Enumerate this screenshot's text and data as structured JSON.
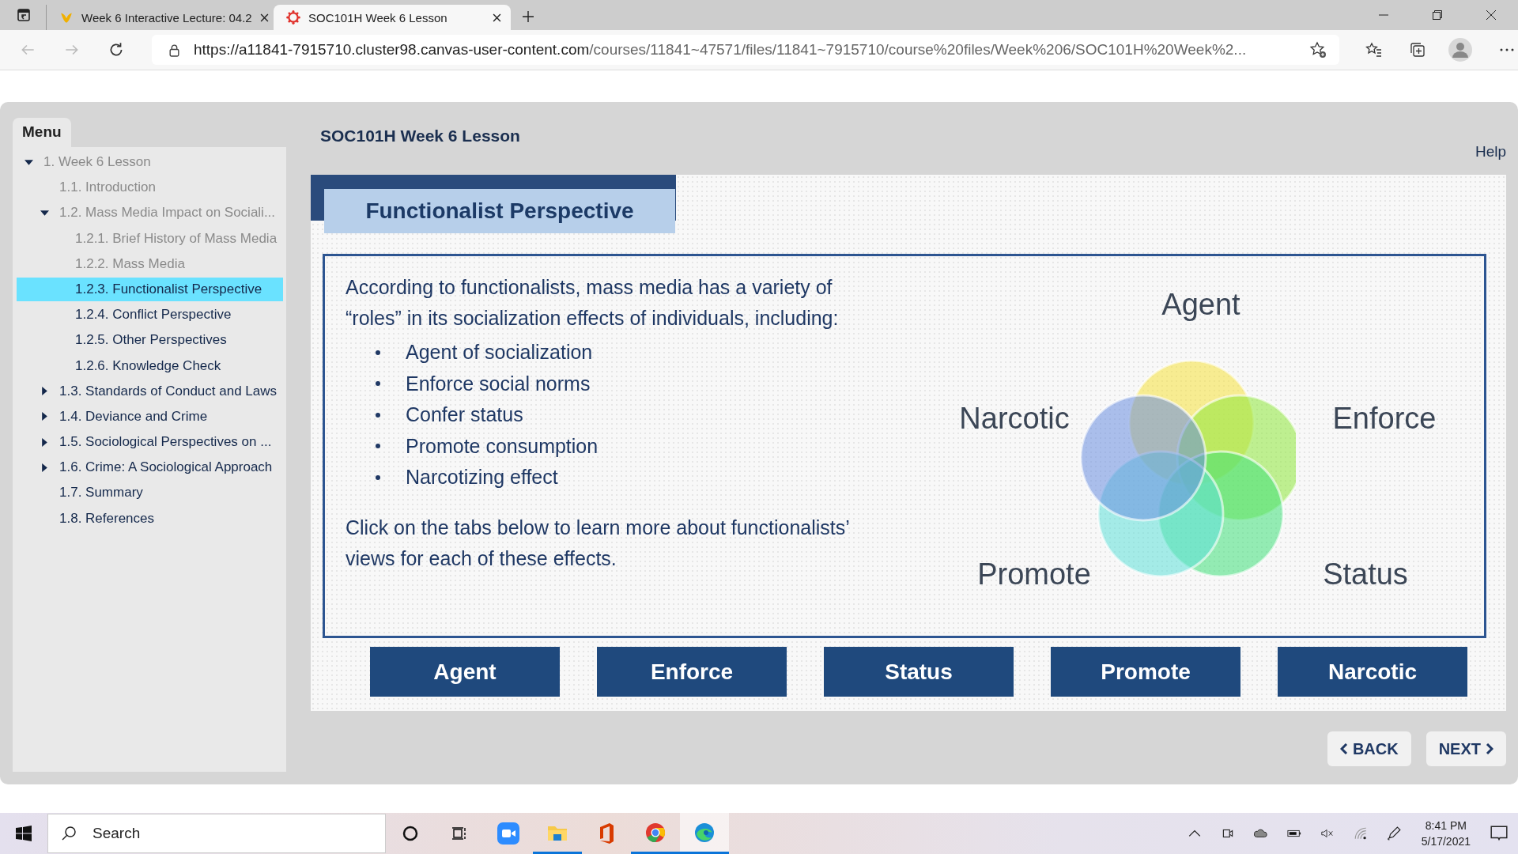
{
  "browser": {
    "tabs": [
      {
        "title": "Week 6 Interactive Lecture: 04.2",
        "selected": false
      },
      {
        "title": "SOC101H Week 6 Lesson",
        "selected": true
      }
    ],
    "url": {
      "host": "https://a11841-7915710.cluster98.canvas-user-content.com",
      "path": "/courses/11841~47571/files/11841~7915710/course%20files/Week%206/SOC101H%20Week%2..."
    }
  },
  "menu": {
    "title": "Menu",
    "items": [
      {
        "label": "1. Week 6 Lesson",
        "visited": true,
        "selected": false,
        "expanded": true,
        "children": [
          {
            "label": "1.1. Introduction",
            "visited": true,
            "selected": false
          },
          {
            "label": "1.2. Mass Media Impact on Sociali...",
            "visited": true,
            "selected": false,
            "expanded": true,
            "children": [
              {
                "label": "1.2.1. Brief History of Mass Media",
                "visited": true,
                "selected": false
              },
              {
                "label": "1.2.2. Mass Media",
                "visited": true,
                "selected": false
              },
              {
                "label": "1.2.3. Functionalist Perspective",
                "visited": false,
                "selected": true
              },
              {
                "label": "1.2.4. Conflict Perspective",
                "visited": false,
                "selected": false
              },
              {
                "label": "1.2.5. Other Perspectives",
                "visited": false,
                "selected": false
              },
              {
                "label": "1.2.6. Knowledge Check",
                "visited": false,
                "selected": false
              }
            ]
          },
          {
            "label": "1.3. Standards of Conduct and Laws",
            "visited": false,
            "selected": false,
            "expanded": false
          },
          {
            "label": "1.4. Deviance and Crime",
            "visited": false,
            "selected": false,
            "expanded": false
          },
          {
            "label": "1.5. Sociological Perspectives on ...",
            "visited": false,
            "selected": false,
            "expanded": false
          },
          {
            "label": "1.6. Crime: A Sociological Approach",
            "visited": false,
            "selected": false,
            "expanded": false
          },
          {
            "label": "1.7. Summary",
            "visited": false,
            "selected": false
          },
          {
            "label": "1.8. References",
            "visited": false,
            "selected": false
          }
        ]
      }
    ]
  },
  "lesson": {
    "title": "SOC101H Week 6 Lesson",
    "help": "Help",
    "slide_title": "Functionalist Perspective",
    "intro": "According to functionalists, mass media has a variety of “roles” in its socialization effects of individuals, including:",
    "bullets": [
      "Agent of socialization",
      "Enforce social norms",
      "Confer status",
      "Promote consumption",
      "Narcotizing effect"
    ],
    "outro": "Click on the tabs below to learn more about functionalists’ views for each of these effects.",
    "diagram_labels": [
      "Agent",
      "Narcotic",
      "Enforce",
      "Promote",
      "Status"
    ],
    "tabs": [
      "Agent",
      "Enforce",
      "Status",
      "Promote",
      "Narcotic"
    ],
    "back": "BACK",
    "next": "NEXT"
  },
  "taskbar": {
    "search_placeholder": "Search",
    "time": "8:41 PM",
    "date": "5/17/2021"
  }
}
